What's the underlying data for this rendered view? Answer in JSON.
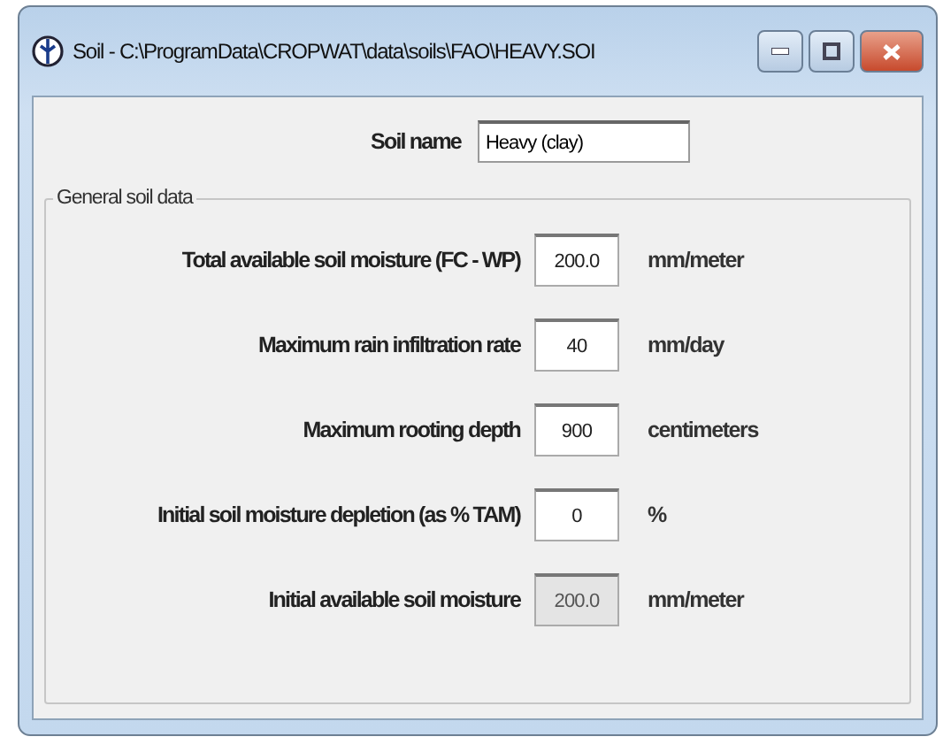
{
  "window": {
    "title": "Soil - C:\\ProgramData\\CROPWAT\\data\\soils\\FAO\\HEAVY.SOI",
    "buttons": [
      {
        "kind": "minimize"
      },
      {
        "kind": "maximize"
      },
      {
        "kind": "close"
      }
    ]
  },
  "soil_name": {
    "label": "Soil name",
    "value": "Heavy (clay)"
  },
  "group": {
    "title": "General soil data",
    "rows": [
      {
        "label": "Total available soil moisture (FC - WP)",
        "value": "200.0",
        "unit": "mm/meter",
        "readonly": false
      },
      {
        "label": "Maximum rain infiltration rate",
        "value": "40",
        "unit": "mm/day",
        "readonly": false
      },
      {
        "label": "Maximum rooting depth",
        "value": "900",
        "unit": "centimeters",
        "readonly": false
      },
      {
        "label": "Initial soil moisture depletion (as % TAM)",
        "value": "0",
        "unit": "%",
        "readonly": false
      },
      {
        "label": "Initial available soil moisture",
        "value": "200.0",
        "unit": "mm/meter",
        "readonly": true
      }
    ]
  }
}
